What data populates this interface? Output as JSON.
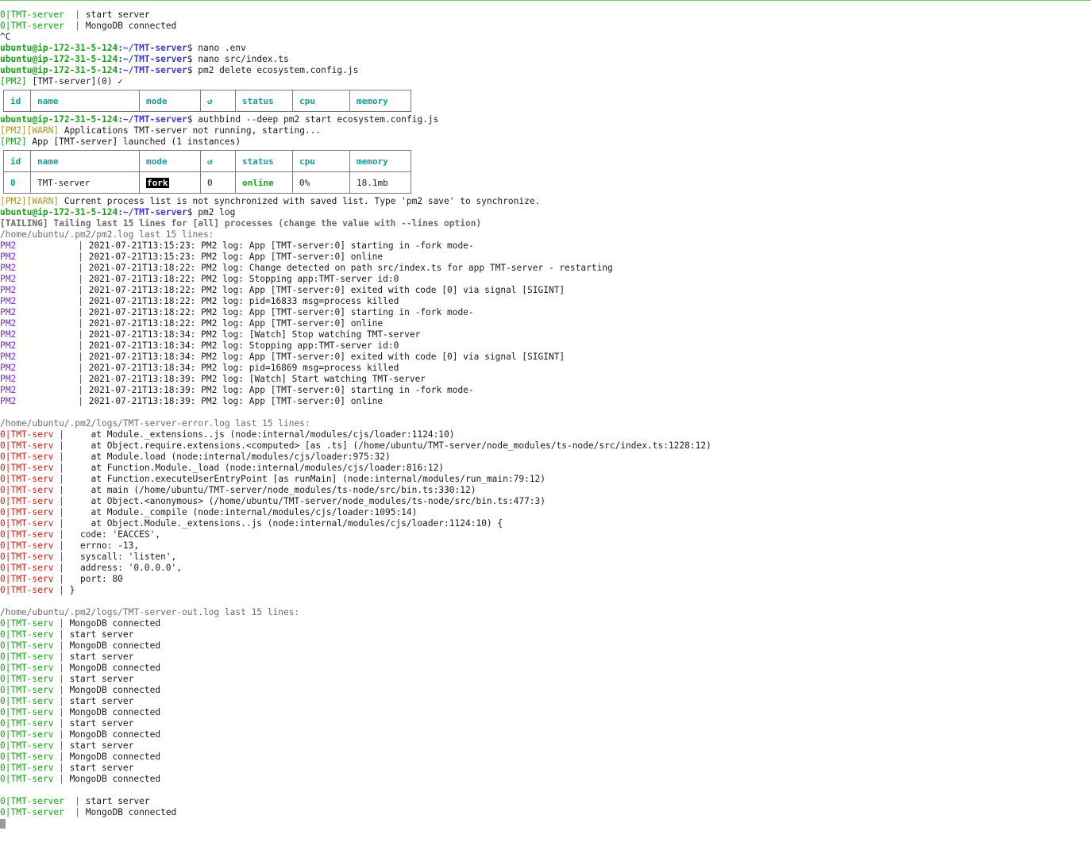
{
  "prompt": {
    "user_host": "ubuntu@ip-172-31-5-124",
    "path": ":~/TMT-server",
    "symbol": "$"
  },
  "top_lines": [
    {
      "prefix": "0|TMT-server  |",
      "text": " start server"
    },
    {
      "prefix": "0|TMT-server  |",
      "text": " MongoDB connected"
    }
  ],
  "ctrl_c": "^C",
  "cmds": {
    "c1": " nano .env",
    "c2": " nano src/index.ts",
    "c3": " pm2 delete ecosystem.config.js",
    "c4": " authbind --deep pm2 start ecosystem.config.js",
    "c5": " pm2 log"
  },
  "pm2_delete": {
    "tag": "[PM2]",
    "text": " [TMT-server](0) ✓"
  },
  "table_headers": [
    "id",
    "name",
    "mode",
    "↺",
    "status",
    "cpu",
    "memory"
  ],
  "process_row": {
    "id": "0",
    "name": "TMT-server",
    "mode": "fork",
    "restarts": "0",
    "status": "online",
    "cpu": "0%",
    "memory": "18.1mb"
  },
  "warn1": {
    "tag": "[PM2][WARN]",
    "text": " Applications TMT-server not running, starting..."
  },
  "launched": {
    "tag": "[PM2]",
    "text": " App [TMT-server] launched (1 instances)"
  },
  "warn2": {
    "tag": "[PM2][WARN]",
    "text": " Current process list is not synchronized with saved list. Type 'pm2 save' to synchronize."
  },
  "tailing": "[TAILING] Tailing last 15 lines for [all] processes (change the value with --lines option)",
  "pm2_log": {
    "header": "/home/ubuntu/.pm2/pm2.log last 15 lines:",
    "prefix": "PM2",
    "sep": "|",
    "lines": [
      " 2021-07-21T13:15:23: PM2 log: App [TMT-server:0] starting in -fork mode-",
      " 2021-07-21T13:15:23: PM2 log: App [TMT-server:0] online",
      " 2021-07-21T13:18:22: PM2 log: Change detected on path src/index.ts for app TMT-server - restarting",
      " 2021-07-21T13:18:22: PM2 log: Stopping app:TMT-server id:0",
      " 2021-07-21T13:18:22: PM2 log: App [TMT-server:0] exited with code [0] via signal [SIGINT]",
      " 2021-07-21T13:18:22: PM2 log: pid=16833 msg=process killed",
      " 2021-07-21T13:18:22: PM2 log: App [TMT-server:0] starting in -fork mode-",
      " 2021-07-21T13:18:22: PM2 log: App [TMT-server:0] online",
      " 2021-07-21T13:18:34: PM2 log: [Watch] Stop watching TMT-server",
      " 2021-07-21T13:18:34: PM2 log: Stopping app:TMT-server id:0",
      " 2021-07-21T13:18:34: PM2 log: App [TMT-server:0] exited with code [0] via signal [SIGINT]",
      " 2021-07-21T13:18:34: PM2 log: pid=16869 msg=process killed",
      " 2021-07-21T13:18:39: PM2 log: [Watch] Start watching TMT-server",
      " 2021-07-21T13:18:39: PM2 log: App [TMT-server:0] starting in -fork mode-",
      " 2021-07-21T13:18:39: PM2 log: App [TMT-server:0] online"
    ]
  },
  "error_log": {
    "header": "/home/ubuntu/.pm2/logs/TMT-server-error.log last 15 lines:",
    "prefix": "0|TMT-serv |",
    "lines": [
      "     at Module._extensions..js (node:internal/modules/cjs/loader:1124:10)",
      "     at Object.require.extensions.<computed> [as .ts] (/home/ubuntu/TMT-server/node_modules/ts-node/src/index.ts:1228:12)",
      "     at Module.load (node:internal/modules/cjs/loader:975:32)",
      "     at Function.Module._load (node:internal/modules/cjs/loader:816:12)",
      "     at Function.executeUserEntryPoint [as runMain] (node:internal/modules/run_main:79:12)",
      "     at main (/home/ubuntu/TMT-server/node_modules/ts-node/src/bin.ts:330:12)",
      "     at Object.<anonymous> (/home/ubuntu/TMT-server/node_modules/ts-node/src/bin.ts:477:3)",
      "     at Module._compile (node:internal/modules/cjs/loader:1095:14)",
      "     at Object.Module._extensions..js (node:internal/modules/cjs/loader:1124:10) {",
      "   code: 'EACCES',",
      "   errno: -13,",
      "   syscall: 'listen',",
      "   address: '0.0.0.0',",
      "   port: 80",
      " }"
    ]
  },
  "out_log": {
    "header": "/home/ubuntu/.pm2/logs/TMT-server-out.log last 15 lines:",
    "prefix": "0|TMT-serv |",
    "lines": [
      " MongoDB connected",
      " start server",
      " MongoDB connected",
      " start server",
      " MongoDB connected",
      " start server",
      " MongoDB connected",
      " start server",
      " MongoDB connected",
      " start server",
      " MongoDB connected",
      " start server",
      " MongoDB connected",
      " start server",
      " MongoDB connected"
    ]
  },
  "bottom_lines": [
    {
      "prefix": "0|TMT-server  |",
      "text": " start server"
    },
    {
      "prefix": "0|TMT-server  |",
      "text": " MongoDB connected"
    }
  ]
}
